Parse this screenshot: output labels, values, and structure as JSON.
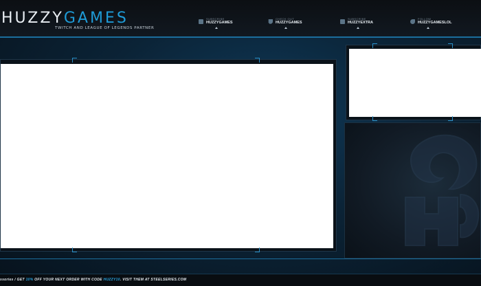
{
  "brand": {
    "part1": "HUZZY",
    "part2": "GAMES",
    "tagline": "TWITCH AND LEAGUE OF LEGENDS PARTNER"
  },
  "socials": [
    {
      "small": "SUBSCRIBE",
      "big": "HUZZYGAMES",
      "icon": "youtube-icon"
    },
    {
      "small": "CHECK OUT",
      "big": "HUZZYGAMES",
      "icon": "twitch-icon"
    },
    {
      "small": "SUBSCRIBE",
      "big": "HUZZYEXTRA",
      "icon": "youtube-icon"
    },
    {
      "small": "FOLLOW",
      "big": "HUZZYGAMESLOL",
      "icon": "twitter-icon"
    }
  ],
  "footer": {
    "part1": "ssories  /  GET ",
    "percent": "10%",
    "part2": " OFF YOUR NEXT ORDER WITH CODE ",
    "code": "HUZZY10",
    "part3": ". VISIT THEM AT STEELSERIES.COM"
  },
  "colors": {
    "accent": "#1e9bd7",
    "background": "#0b2336",
    "text": "#e9eef3"
  }
}
